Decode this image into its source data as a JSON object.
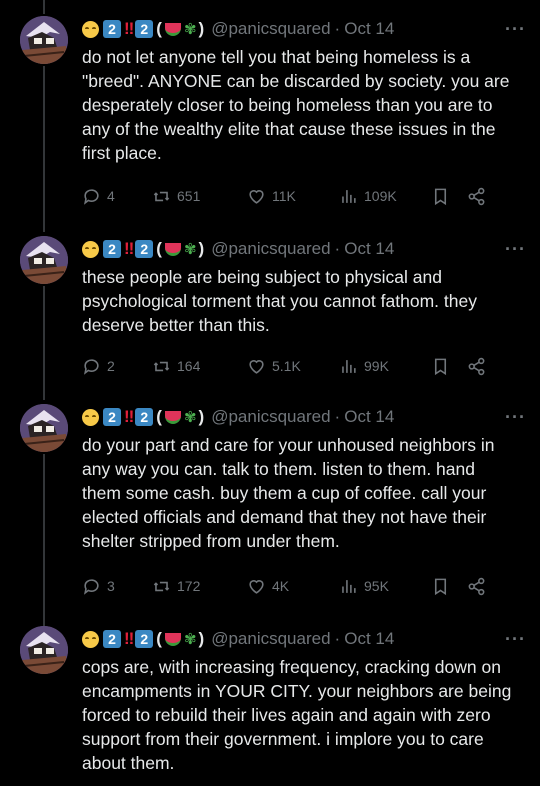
{
  "colors": {
    "background": "#000000",
    "text": "#e7e9ea",
    "muted": "#71767b",
    "keycap": "#3b88c3",
    "bang": "#e0203a"
  },
  "display_name": {
    "emoji_1": "smiling-face-emoji",
    "keycap_1": "2",
    "bangs": "‼",
    "keycap_2": "2",
    "open_paren": "(",
    "emoji_2": "watermelon-emoji",
    "emoji_3": "herb-emoji",
    "close_paren": ")"
  },
  "tweets": [
    {
      "handle": "@panicsquared",
      "sep": "·",
      "date": "Oct 14",
      "more": "···",
      "text": "do not let anyone tell you that being homeless is a \"breed\". ANYONE can be discarded by society. you are desperately closer to being homeless than you are to any of the wealthy elite that cause these issues in the first place.",
      "replies": "4",
      "reposts": "651",
      "likes": "11K",
      "views": "109K"
    },
    {
      "handle": "@panicsquared",
      "sep": "·",
      "date": "Oct 14",
      "more": "···",
      "text": "these people are being subject to physical and psychological torment that you cannot fathom. they deserve better than this.",
      "replies": "2",
      "reposts": "164",
      "likes": "5.1K",
      "views": "99K"
    },
    {
      "handle": "@panicsquared",
      "sep": "·",
      "date": "Oct 14",
      "more": "···",
      "text": "do your part and care for your unhoused neighbors in any way you can. talk to them. listen to them. hand them some cash. buy them a cup of coffee. call your elected officials and demand that they not have their shelter stripped from under them.",
      "replies": "3",
      "reposts": "172",
      "likes": "4K",
      "views": "95K"
    },
    {
      "handle": "@panicsquared",
      "sep": "·",
      "date": "Oct 14",
      "more": "···",
      "text": "cops are, with increasing frequency, cracking down on encampments in YOUR CITY. your neighbors are being forced to rebuild their lives again and again with zero support from their government. i implore you to care about them."
    }
  ]
}
